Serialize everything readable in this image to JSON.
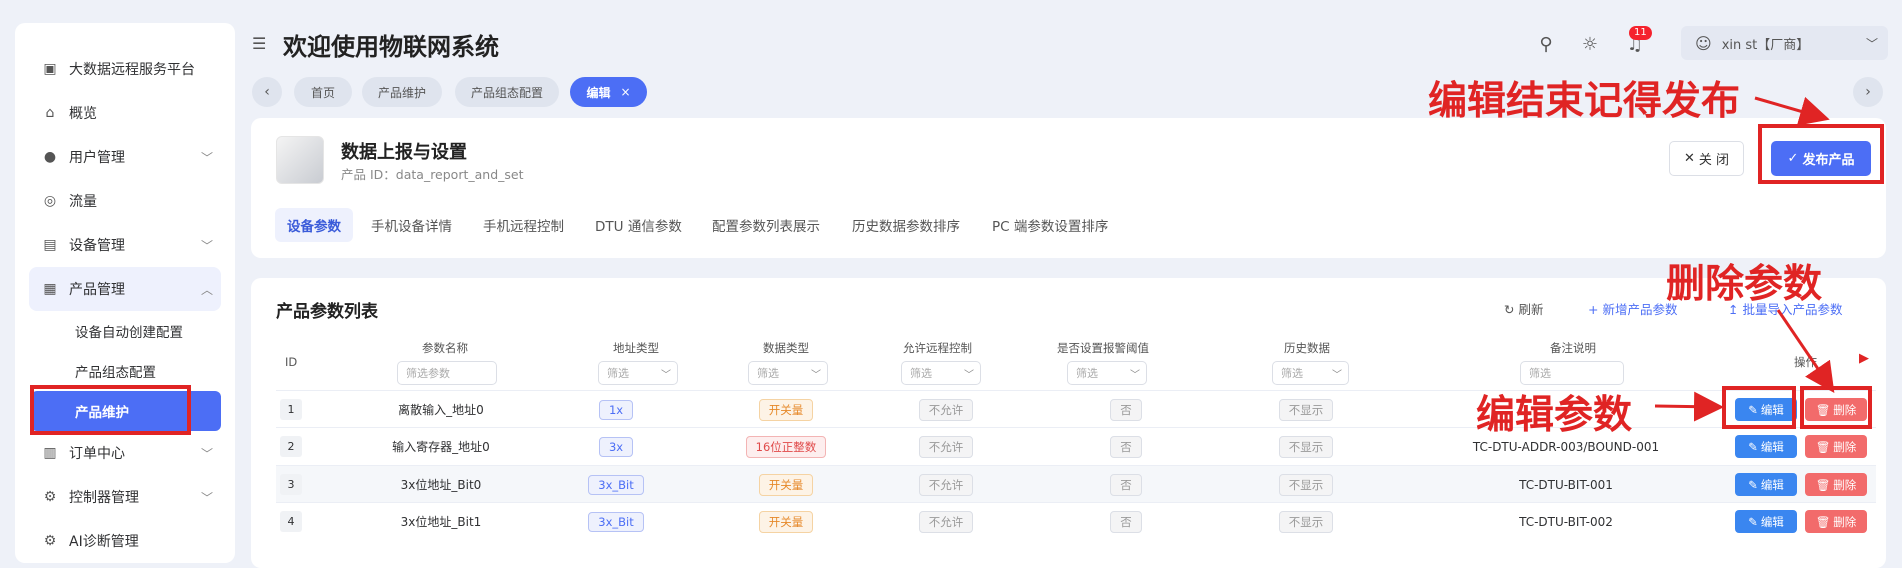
{
  "sidebar": {
    "items": [
      {
        "label": "大数据远程服务平台",
        "icon": "platform-icon"
      },
      {
        "label": "概览",
        "icon": "home-icon"
      },
      {
        "label": "用户管理",
        "icon": "user-icon"
      },
      {
        "label": "流量",
        "icon": "traffic-icon"
      },
      {
        "label": "设备管理",
        "icon": "device-icon"
      },
      {
        "label": "产品管理",
        "icon": "product-icon"
      },
      {
        "label": "订单中心",
        "icon": "order-icon"
      },
      {
        "label": "控制器管理",
        "icon": "gear-icon"
      },
      {
        "label": "AI诊断管理",
        "icon": "ai-icon"
      }
    ],
    "sub_items": [
      "设备自动创建配置",
      "产品组态配置",
      "产品维护"
    ]
  },
  "header": {
    "title": "欢迎使用物联网系统",
    "notification_count": "11",
    "user": "xin                st【厂商】"
  },
  "tabs": [
    "首页",
    "产品维护",
    "产品组态配置",
    "编辑"
  ],
  "product": {
    "title": "数据上报与设置",
    "id": "产品 ID：data_report_and_set",
    "close_label": "关 闭",
    "publish_label": "发布产品",
    "sub_tabs": [
      "设备参数",
      "手机设备详情",
      "手机远程控制",
      "DTU 通信参数",
      "配置参数列表展示",
      "历史数据参数排序",
      "PC 端参数设置排序"
    ]
  },
  "table": {
    "title": "产品参数列表",
    "refresh": "刷新",
    "add": "新增产品参数",
    "import": "批量导入产品参数",
    "headers": [
      "ID",
      "参数名称",
      "地址类型",
      "数据类型",
      "允许远程控制",
      "是否设置报警阈值",
      "历史数据",
      "备注说明",
      "操作"
    ],
    "filters": {
      "name": "筛选参数",
      "select": "筛选",
      "remark": "筛选"
    },
    "edit_label": "编辑",
    "delete_label": "删除",
    "rows": [
      {
        "id": "1",
        "name": "离散输入_地址0",
        "addr": "1x",
        "dtype": "开关量",
        "dtype_color": "orange",
        "remote": "不允许",
        "alarm": "否",
        "history": "不显示",
        "remark": ""
      },
      {
        "id": "2",
        "name": "输入寄存器_地址0",
        "addr": "3x",
        "dtype": "16位正整数",
        "dtype_color": "red",
        "remote": "不允许",
        "alarm": "否",
        "history": "不显示",
        "remark": "TC-DTU-ADDR-003/BOUND-001"
      },
      {
        "id": "3",
        "name": "3x位地址_Bit0",
        "addr": "3x_Bit",
        "dtype": "开关量",
        "dtype_color": "orange",
        "remote": "不允许",
        "alarm": "否",
        "history": "不显示",
        "remark": "TC-DTU-BIT-001"
      },
      {
        "id": "4",
        "name": "3x位地址_Bit1",
        "addr": "3x_Bit",
        "dtype": "开关量",
        "dtype_color": "orange",
        "remote": "不允许",
        "alarm": "否",
        "history": "不显示",
        "remark": "TC-DTU-BIT-002"
      }
    ]
  },
  "annotations": {
    "publish_note": "编辑结束记得发布",
    "delete_note": "删除参数",
    "edit_note": "编辑参数"
  }
}
